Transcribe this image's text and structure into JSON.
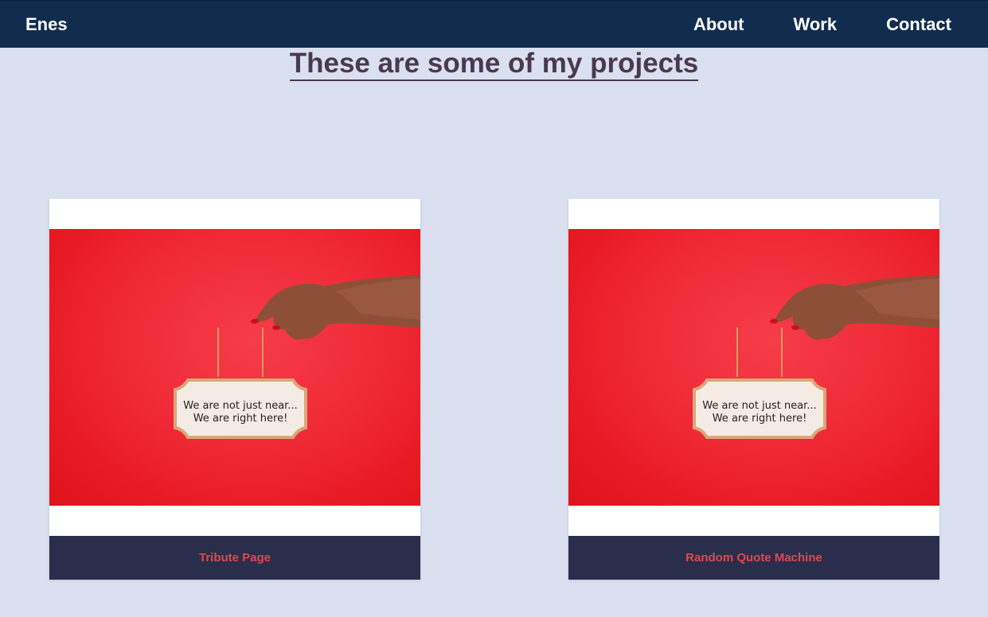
{
  "nav": {
    "brand": "Enes",
    "links": [
      "About",
      "Work",
      "Contact"
    ]
  },
  "main": {
    "title": "These are some of my projects"
  },
  "projects": [
    {
      "caption": "Tribute Page",
      "sign_line1": "We are not just near...",
      "sign_line2": "We are right here!"
    },
    {
      "caption": "Random Quote Machine",
      "sign_line1": "We are not just near...",
      "sign_line2": "We are right here!"
    }
  ],
  "colors": {
    "nav_bg": "#112d4e",
    "page_bg": "#dae0ef",
    "title": "#4a3a4c",
    "caption_bg": "#2a2d4b",
    "caption_text": "#e0484f",
    "image_red": "#ef2a36"
  }
}
